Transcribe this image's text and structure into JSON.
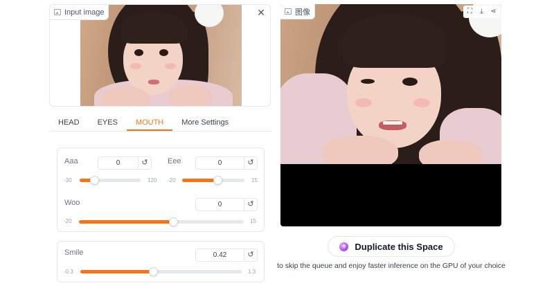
{
  "input_card": {
    "label": "Input image",
    "close_glyph": "✕",
    "label_icon": "image-icon",
    "close_icon": "close-icon"
  },
  "tabs": [
    {
      "label": "HEAD",
      "active": false
    },
    {
      "label": "EYES",
      "active": false
    },
    {
      "label": "MOUTH",
      "active": true
    },
    {
      "label": "More Settings",
      "active": false
    }
  ],
  "sliders": {
    "aaa": {
      "label": "Aaa",
      "value": "0",
      "min": "-30",
      "max": "120"
    },
    "eee": {
      "label": "Eee",
      "value": "0",
      "min": "-20",
      "max": "15"
    },
    "woo": {
      "label": "Woo",
      "value": "0",
      "min": "-20",
      "max": "15"
    },
    "smile": {
      "label": "Smile",
      "value": "0.42",
      "min": "-0.3",
      "max": "1.3"
    },
    "reset_glyph": "↺"
  },
  "output_card": {
    "label": "图像",
    "tools": [
      {
        "name": "fullscreen-icon",
        "glyph": "⛶"
      },
      {
        "name": "download-icon",
        "glyph": "⤓"
      },
      {
        "name": "share-icon",
        "glyph": "⋖"
      }
    ]
  },
  "duplicate": {
    "label": "Duplicate this Space",
    "hint": "to skip the queue and enjoy faster inference on the GPU of your choice"
  },
  "colors": {
    "accent": "#f97316",
    "track": "#e5e7eb",
    "output_bg": "#000000"
  }
}
